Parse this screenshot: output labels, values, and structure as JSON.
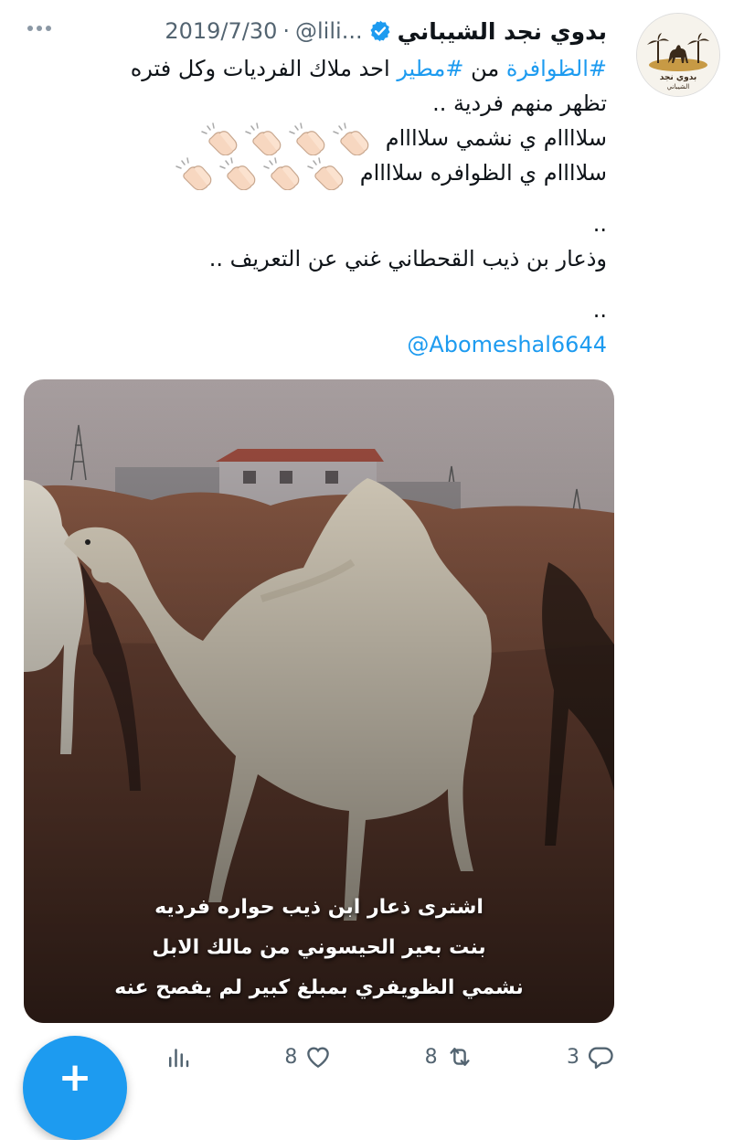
{
  "author": {
    "display_name": "بدوي نجد الشيباني",
    "handle": "@lili...",
    "date": "2019/7/30",
    "separator": "·",
    "avatar_text_top": "بدوي نجد",
    "avatar_text_bottom": "الشيباني"
  },
  "tweet": {
    "hashtag_1": "#الظوافرة",
    "word_min": "من",
    "hashtag_2": "#مطير",
    "line1_rest": "احد ملاك الفرديات وكل فتره",
    "line2": "تظهر منهم فردية ..",
    "line3": "سلاااام ي نشمي سلاااام",
    "line4": "سلاااام ي الظوافره سلاااام",
    "line5": "..",
    "line6": "وذعار بن ذيب القحطاني غني عن التعريف ..",
    "line7": "..",
    "mention": "@Abomeshal6644"
  },
  "media": {
    "caption_line1": "اشترى ذعار ابن ذيب حواره فرديه",
    "caption_line2": "بنت بعير الحيسوني من مالك الابل",
    "caption_line3": "نشمي الظويفري بمبلغ كبير لم يفصح عنه"
  },
  "actions": {
    "reply_count": "3",
    "retweet_count": "8",
    "like_count": "8"
  },
  "fab": {
    "label": "+"
  },
  "colors": {
    "accent": "#1d9bf0",
    "text": "#0f1419",
    "secondary": "#536471"
  },
  "icons": [
    "more-options-icon",
    "verified-badge-icon",
    "clap-emoji-icon",
    "reply-icon",
    "retweet-icon",
    "like-icon",
    "analytics-icon",
    "compose-plus-icon"
  ]
}
